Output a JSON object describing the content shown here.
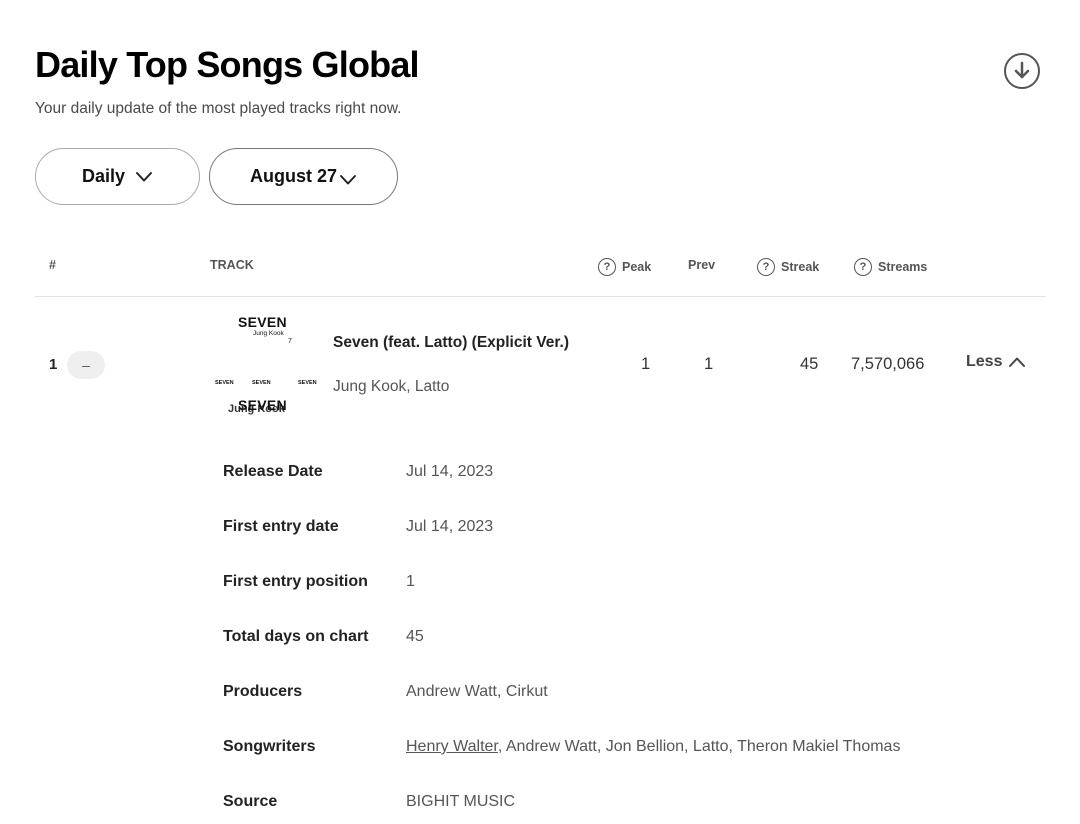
{
  "header": {
    "title": "Daily Top Songs Global",
    "subtitle": "Your daily update of the most played tracks right now."
  },
  "filters": {
    "period_label": "Daily",
    "date_label": "August 27"
  },
  "table": {
    "columns": {
      "rank": "#",
      "track": "TRACK",
      "peak": "Peak",
      "prev": "Prev",
      "streak": "Streak",
      "streams": "Streams"
    },
    "row": {
      "rank": "1",
      "change": "–",
      "cover_text": {
        "main": "SEVEN",
        "artist": "Jung Kook",
        "mark": "7",
        "small": "SEVEN",
        "artist_big": "Jung Kook"
      },
      "title": "Seven (feat. Latto) (Explicit Ver.)",
      "artists": "Jung Kook, Latto",
      "peak": "1",
      "prev": "1",
      "streak": "45",
      "streams": "7,570,066",
      "toggle_label": "Less"
    }
  },
  "details": {
    "release_date": {
      "label": "Release Date",
      "value": "Jul 14, 2023"
    },
    "first_entry_date": {
      "label": "First entry date",
      "value": "Jul 14, 2023"
    },
    "first_entry_position": {
      "label": "First entry position",
      "value": "1"
    },
    "total_days": {
      "label": "Total days on chart",
      "value": "45"
    },
    "producers": {
      "label": "Producers",
      "value": "Andrew Watt, Cirkut"
    },
    "songwriters": {
      "label": "Songwriters",
      "link": "Henry Walter",
      "rest": ", Andrew Watt, Jon Bellion, Latto, Theron Makiel Thomas"
    },
    "source": {
      "label": "Source",
      "value": "BIGHIT MUSIC"
    }
  },
  "colors": {
    "accent": "#000000",
    "muted": "#555555",
    "divider": "#e3e3e3"
  },
  "icons": {
    "download": "download-circle-icon",
    "chevron": "chevron-down-icon",
    "help": "question-circle-icon",
    "collapse": "chevron-up-icon"
  }
}
